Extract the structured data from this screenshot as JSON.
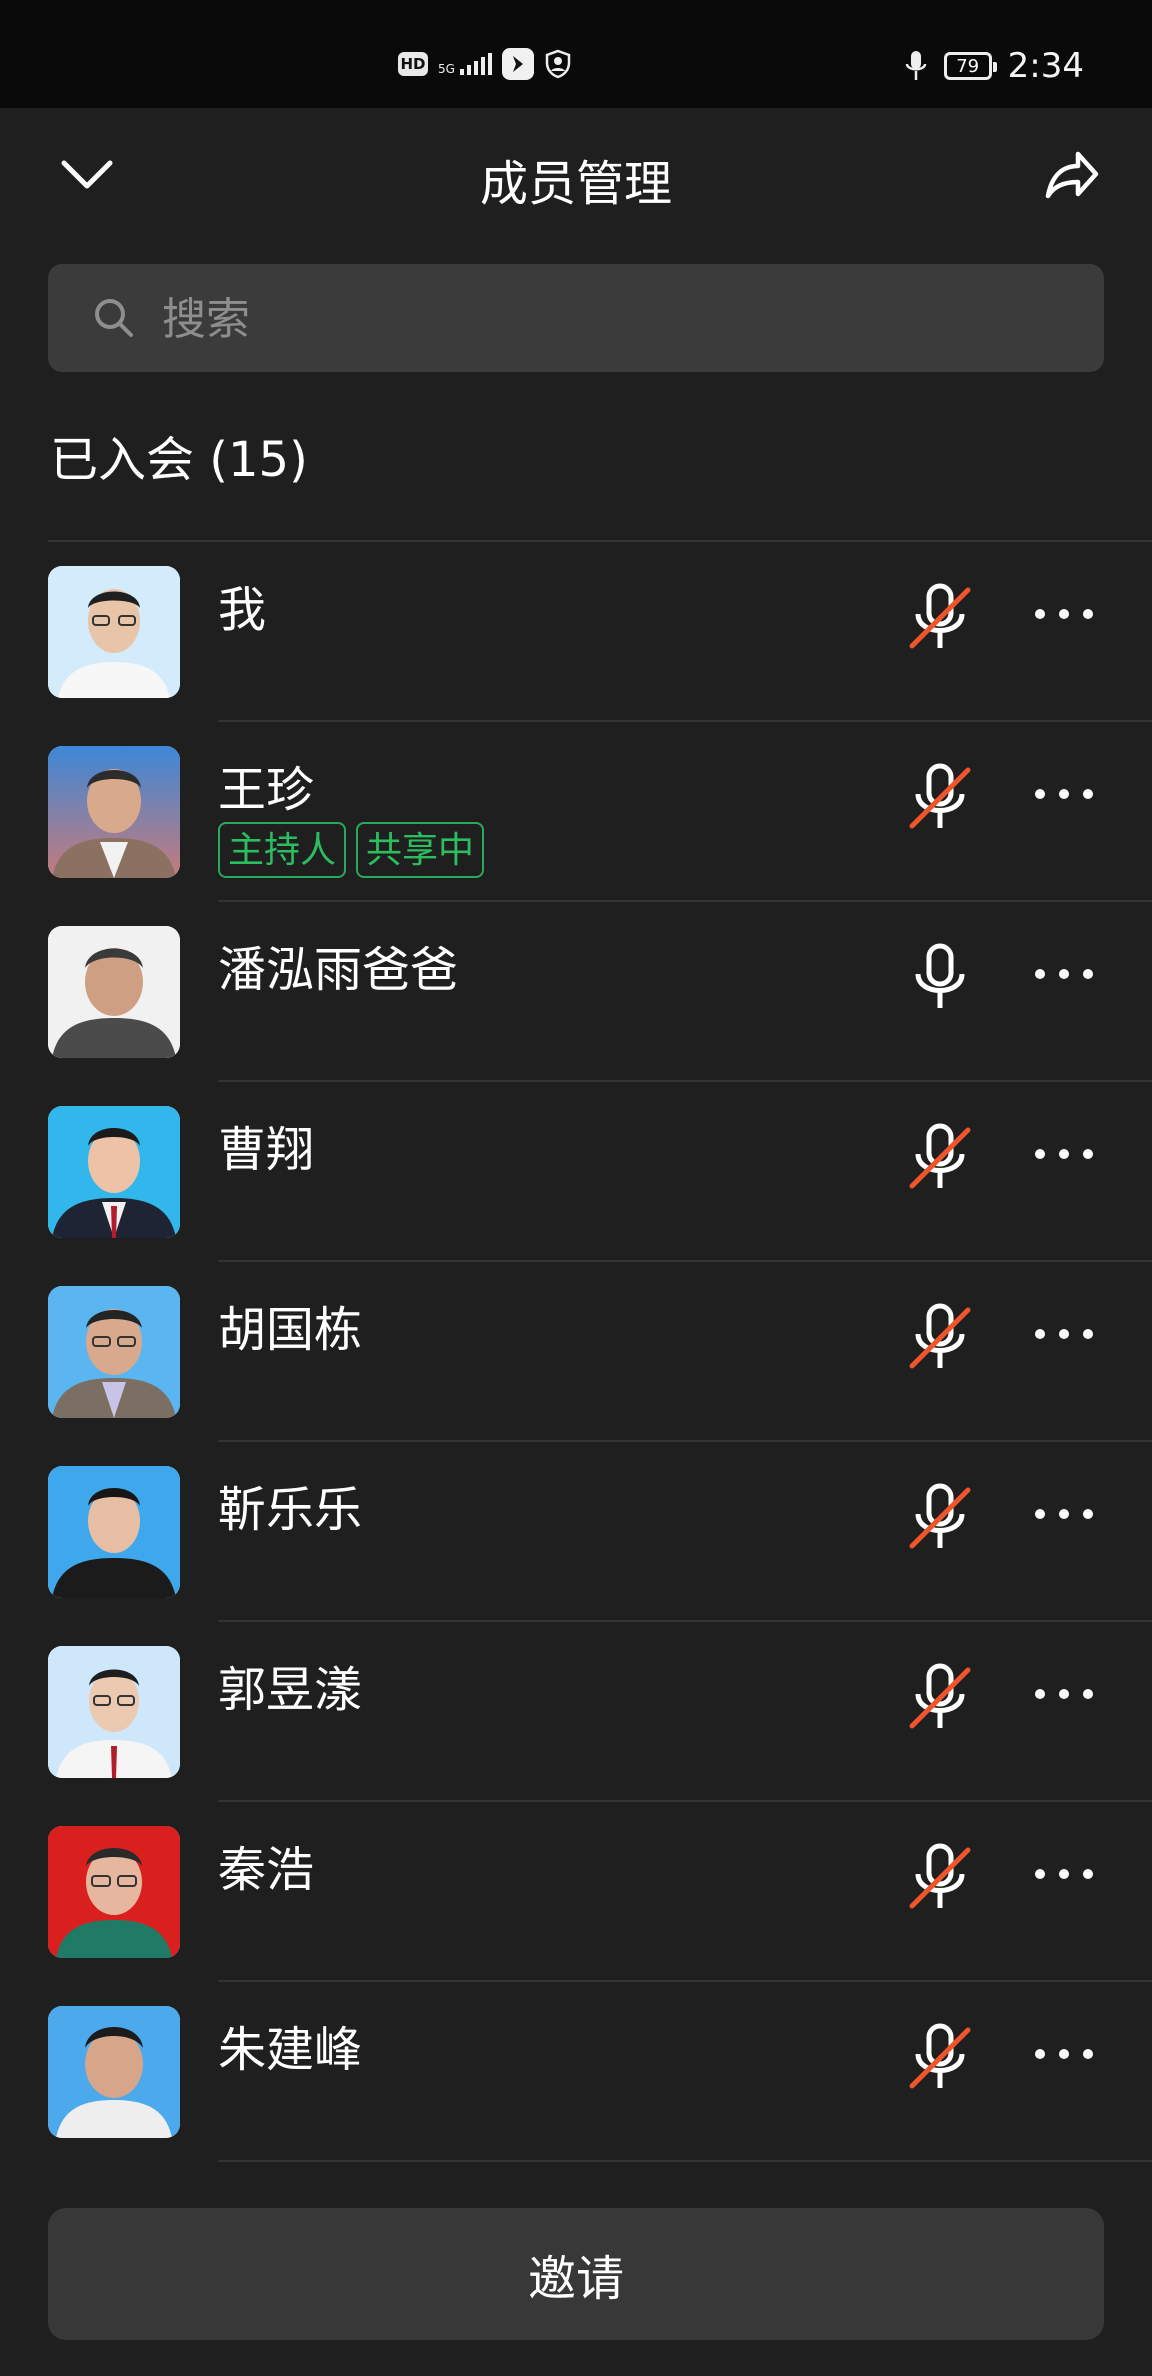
{
  "status_bar": {
    "hd": "HD",
    "network": "5G",
    "battery": "79",
    "time": "2:34"
  },
  "header": {
    "title": "成员管理"
  },
  "search": {
    "placeholder": "搜索"
  },
  "section": {
    "title": "已入会 (15)"
  },
  "members": [
    {
      "name": "我",
      "tags": [],
      "mic": "muted"
    },
    {
      "name": "王珍",
      "tags": [
        "主持人",
        "共享中"
      ],
      "mic": "muted"
    },
    {
      "name": "潘泓雨爸爸",
      "tags": [],
      "mic": "on"
    },
    {
      "name": "曹翔",
      "tags": [],
      "mic": "muted"
    },
    {
      "name": "胡国栋",
      "tags": [],
      "mic": "muted"
    },
    {
      "name": "靳乐乐",
      "tags": [],
      "mic": "muted"
    },
    {
      "name": "郭昱漾",
      "tags": [],
      "mic": "muted"
    },
    {
      "name": "秦浩",
      "tags": [],
      "mic": "muted"
    },
    {
      "name": "朱建峰",
      "tags": [],
      "mic": "muted"
    }
  ],
  "actions": {
    "invite": "邀请"
  },
  "colors": {
    "background": "#1f1f1f",
    "muted_slash": "#f0542b",
    "tag_green": "#2dbd61"
  }
}
